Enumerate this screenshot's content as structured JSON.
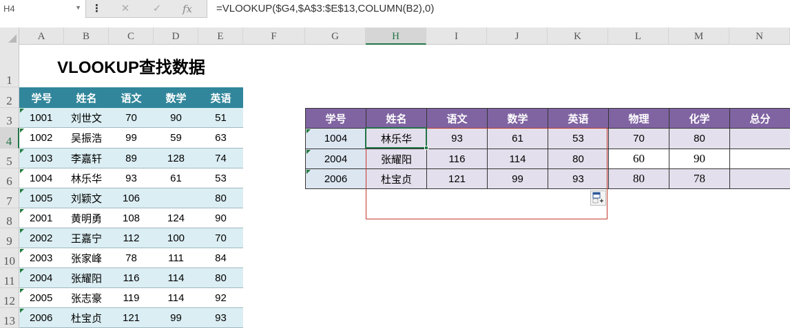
{
  "formula_bar": {
    "name_box": "H4",
    "cancel_icon": "✕",
    "enter_icon": "✓",
    "fx_label": "fx",
    "formula": "=VLOOKUP($G4,$A$3:$E$13,COLUMN(B2),0)"
  },
  "columns": [
    "A",
    "B",
    "C",
    "D",
    "E",
    "F",
    "G",
    "H",
    "I",
    "J",
    "K",
    "L",
    "M",
    "N"
  ],
  "rows": [
    "1",
    "2",
    "3",
    "4",
    "5",
    "6",
    "7",
    "8",
    "9",
    "10",
    "11",
    "12",
    "13"
  ],
  "selected_column": "H",
  "selected_row": "4",
  "title": "VLOOKUP查找数据",
  "left_table": {
    "headers": [
      "学号",
      "姓名",
      "语文",
      "数学",
      "英语"
    ],
    "rows": [
      [
        "1001",
        "刘世文",
        "70",
        "90",
        "51"
      ],
      [
        "1002",
        "吴振浩",
        "99",
        "59",
        "63"
      ],
      [
        "1003",
        "李嘉轩",
        "89",
        "128",
        "74"
      ],
      [
        "1004",
        "林乐华",
        "93",
        "61",
        "53"
      ],
      [
        "1005",
        "刘颖文",
        "106",
        "",
        "80"
      ],
      [
        "2001",
        "黄明勇",
        "108",
        "124",
        "90"
      ],
      [
        "2002",
        "王嘉宁",
        "112",
        "100",
        "70"
      ],
      [
        "2003",
        "张家峰",
        "78",
        "111",
        "84"
      ],
      [
        "2004",
        "张耀阳",
        "116",
        "114",
        "80"
      ],
      [
        "2005",
        "张志豪",
        "119",
        "114",
        "92"
      ],
      [
        "2006",
        "杜宝贞",
        "121",
        "99",
        "93"
      ]
    ]
  },
  "right_table": {
    "headers": [
      "学号",
      "姓名",
      "语文",
      "数学",
      "英语",
      "物理",
      "化学",
      "总分"
    ],
    "rows": [
      [
        "1004",
        "林乐华",
        "93",
        "61",
        "53",
        "70",
        "80",
        ""
      ],
      [
        "2004",
        "张耀阳",
        "116",
        "114",
        "80",
        "60",
        "90",
        ""
      ],
      [
        "2006",
        "杜宝贞",
        "121",
        "99",
        "93",
        "80",
        "78",
        ""
      ]
    ]
  },
  "colors": {
    "left_header": "#31869b",
    "left_band": "#dbeef3",
    "right_header": "#8064a2",
    "right_fill": "#e4dfec",
    "accent": "#217346",
    "selection_border": "#c0392b"
  }
}
